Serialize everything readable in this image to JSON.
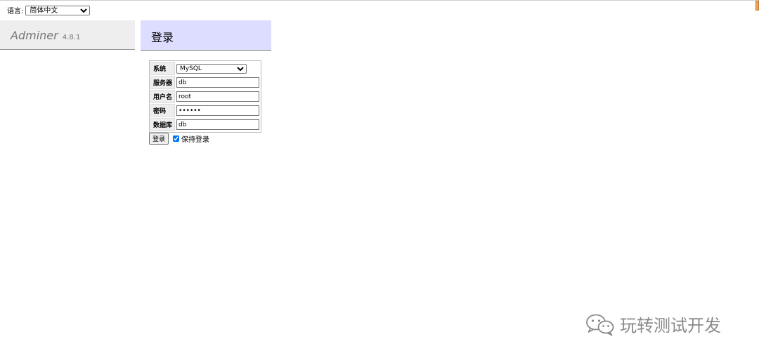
{
  "language": {
    "label": "语言:",
    "selected": "简体中文"
  },
  "app": {
    "name": "Adminer",
    "version": "4.8.1"
  },
  "page": {
    "heading": "登录"
  },
  "login_form": {
    "fields": [
      {
        "label": "系统",
        "type": "select",
        "value": "MySQL"
      },
      {
        "label": "服务器",
        "type": "text",
        "value": "db"
      },
      {
        "label": "用户名",
        "type": "text",
        "value": "root"
      },
      {
        "label": "密码",
        "type": "password",
        "value": "••••••"
      },
      {
        "label": "数据库",
        "type": "text",
        "value": "db"
      }
    ],
    "submit_label": "登录",
    "remember_label": "保持登录",
    "remember_checked": true
  },
  "watermark": {
    "text": "玩转测试开发",
    "icon": "wechat-icon"
  },
  "colors": {
    "menu_bg": "#eeeeee",
    "heading_bg": "#ddddff",
    "scroll_marker": "#f0a35a"
  }
}
